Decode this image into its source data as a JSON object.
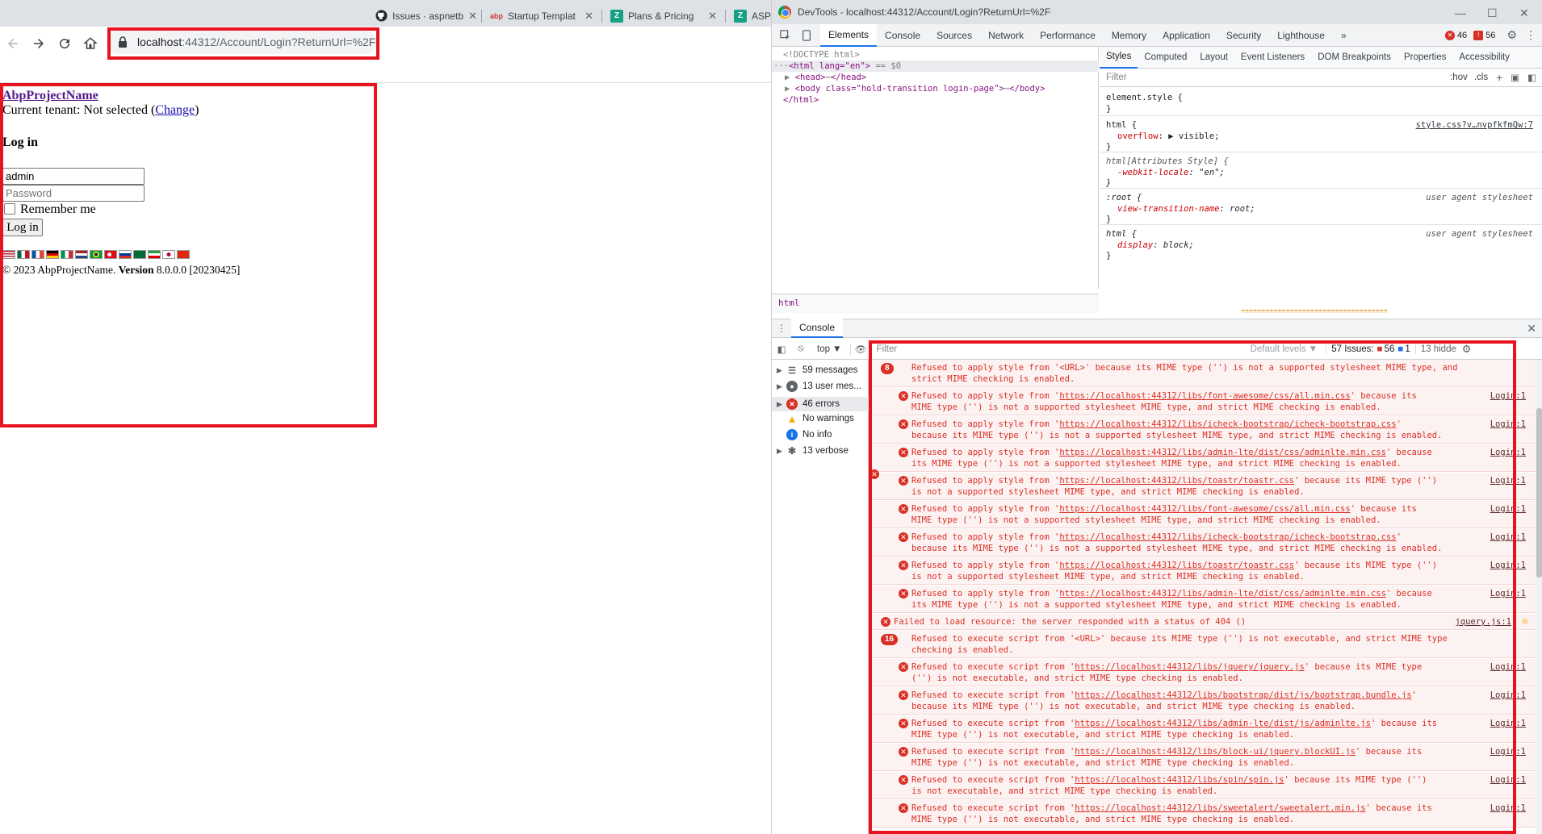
{
  "browser": {
    "tabs": [
      {
        "title": "Issues · aspnetb",
        "icon": "github-icon"
      },
      {
        "title": "Startup Templat",
        "icon": "abp-icon"
      },
      {
        "title": "Plans & Pricing",
        "icon": "zero-icon"
      },
      {
        "title": "ASP",
        "icon": "zero-icon"
      }
    ],
    "url_host": "localhost",
    "url_rest": ":44312/Account/Login?ReturnUrl=%2F"
  },
  "page": {
    "brand": "AbpProjectName",
    "tenant_label": "Current tenant: Not selected (",
    "tenant_change": "Change",
    "tenant_close": ")",
    "login_heading": "Log in",
    "username_value": "admin",
    "password_placeholder": "Password",
    "remember_label": "Remember me",
    "login_button": "Log in",
    "flags": [
      "us",
      "mx",
      "fr",
      "de",
      "it",
      "nl",
      "br",
      "tr",
      "ru",
      "sa",
      "ir",
      "jp",
      "cn"
    ],
    "footer_copy": "© 2023 AbpProjectName.",
    "footer_version_label": "Version",
    "footer_version": "8.0.0.0 [20230425]"
  },
  "devtools": {
    "title": "DevTools - localhost:44312/Account/Login?ReturnUrl=%2F",
    "tabs": [
      "Elements",
      "Console",
      "Sources",
      "Network",
      "Performance",
      "Memory",
      "Application",
      "Security",
      "Lighthouse"
    ],
    "more": "»",
    "error_count": "46",
    "issue_count": "56",
    "elements": {
      "doctype": "<!DOCTYPE html>",
      "html_open": "<html lang=\"en\">",
      "html_eq": "== $0",
      "head": "<head>",
      "head_close": "</head>",
      "body_tag": "<body class=\"hold-transition login-page\">",
      "body_close": "</body>",
      "html_close": "</html>",
      "crumb": "html"
    },
    "styles_tabs": [
      "Styles",
      "Computed",
      "Layout",
      "Event Listeners",
      "DOM Breakpoints",
      "Properties",
      "Accessibility"
    ],
    "styles_filter": "Filter",
    "styles_hov": ":hov",
    "styles_cls": ".cls",
    "rules": [
      {
        "selector": "element.style {",
        "props": [],
        "close": "}",
        "source": ""
      },
      {
        "selector": "html {",
        "props": [
          {
            "name": "overflow",
            "value": "▶ visible;"
          }
        ],
        "close": "}",
        "source": "style.css?v…nvpfkfmQw:7"
      },
      {
        "selector": "html[Attributes Style] {",
        "props": [
          {
            "name": "-webkit-locale",
            "value": "\"en\";"
          }
        ],
        "close": "}",
        "source": ""
      },
      {
        "selector": ":root {",
        "props": [
          {
            "name": "view-transition-name",
            "value": "root;"
          }
        ],
        "close": "}",
        "source": "user agent stylesheet"
      },
      {
        "selector": "html {",
        "props": [
          {
            "name": "display",
            "value": "block;"
          }
        ],
        "close": "}",
        "source": "user agent stylesheet"
      }
    ],
    "console": {
      "title": "Console",
      "context": "top ▼",
      "filter": "Filter",
      "levels": "Default levels ▼",
      "issues_label": "57 Issues:",
      "issues_err": "56",
      "issues_info": "1",
      "hidden": "13 hidde",
      "sidebar": [
        {
          "label": "59 messages",
          "icon": "list-icon"
        },
        {
          "label": "13 user mes...",
          "icon": "user-icon"
        },
        {
          "label": "46 errors",
          "icon": "error-icon"
        },
        {
          "label": "No warnings",
          "icon": "warning-icon"
        },
        {
          "label": "No info",
          "icon": "info-icon"
        },
        {
          "label": "13 verbose",
          "icon": "bug-icon"
        }
      ],
      "messages": [
        {
          "kind": "group",
          "count": "8",
          "l1": "Refused to apply style from '<URL>' because its MIME type ('') is not a supported stylesheet MIME type, and",
          "l2": "strict MIME checking is enabled.",
          "src": ""
        },
        {
          "kind": "item",
          "pre": "Refused to apply style from '",
          "url": "https://localhost:44312/libs/font-awesome/css/all.min.css",
          "post": "' because its",
          "l2": "MIME type ('') is not a supported stylesheet MIME type, and strict MIME checking is enabled.",
          "src": "Login:1"
        },
        {
          "kind": "item",
          "pre": "Refused to apply style from '",
          "url": "https://localhost:44312/libs/icheck-bootstrap/icheck-bootstrap.css",
          "post": "'",
          "l2": "because its MIME type ('') is not a supported stylesheet MIME type, and strict MIME checking is enabled.",
          "src": "Login:1"
        },
        {
          "kind": "item",
          "pre": "Refused to apply style from '",
          "url": "https://localhost:44312/libs/admin-lte/dist/css/adminlte.min.css",
          "post": "' because",
          "l2": "its MIME type ('') is not a supported stylesheet MIME type, and strict MIME checking is enabled.",
          "src": "Login:1"
        },
        {
          "kind": "item",
          "pre": "Refused to apply style from '",
          "url": "https://localhost:44312/libs/toastr/toastr.css",
          "post": "' because its MIME type ('')",
          "l2": "is not a supported stylesheet MIME type, and strict MIME checking is enabled.",
          "src": "Login:1"
        },
        {
          "kind": "item",
          "pre": "Refused to apply style from '",
          "url": "https://localhost:44312/libs/font-awesome/css/all.min.css",
          "post": "' because its",
          "l2": "MIME type ('') is not a supported stylesheet MIME type, and strict MIME checking is enabled.",
          "src": "Login:1"
        },
        {
          "kind": "item",
          "pre": "Refused to apply style from '",
          "url": "https://localhost:44312/libs/icheck-bootstrap/icheck-bootstrap.css",
          "post": "'",
          "l2": "because its MIME type ('') is not a supported stylesheet MIME type, and strict MIME checking is enabled.",
          "src": "Login:1"
        },
        {
          "kind": "item",
          "pre": "Refused to apply style from '",
          "url": "https://localhost:44312/libs/toastr/toastr.css",
          "post": "' because its MIME type ('')",
          "l2": "is not a supported stylesheet MIME type, and strict MIME checking is enabled.",
          "src": "Login:1"
        },
        {
          "kind": "item",
          "pre": "Refused to apply style from '",
          "url": "https://localhost:44312/libs/admin-lte/dist/css/adminlte.min.css",
          "post": "' because",
          "l2": "its MIME type ('') is not a supported stylesheet MIME type, and strict MIME checking is enabled.",
          "src": "Login:1"
        },
        {
          "kind": "single",
          "l1": "Failed to load resource: the server responded with a status of 404 ()",
          "src": "jquery.js:1"
        },
        {
          "kind": "group",
          "count": "16",
          "l1": "Refused to execute script from '<URL>' because its MIME type ('') is not executable, and strict MIME type",
          "l2": "checking is enabled.",
          "src": ""
        },
        {
          "kind": "item",
          "pre": "Refused to execute script from '",
          "url": "https://localhost:44312/libs/jquery/jquery.js",
          "post": "' because its MIME type",
          "l2": "('') is not executable, and strict MIME type checking is enabled.",
          "src": "Login:1"
        },
        {
          "kind": "item",
          "pre": "Refused to execute script from '",
          "url": "https://localhost:44312/libs/bootstrap/dist/js/bootstrap.bundle.js",
          "post": "'",
          "l2": "because its MIME type ('') is not executable, and strict MIME type checking is enabled.",
          "src": "Login:1"
        },
        {
          "kind": "item",
          "pre": "Refused to execute script from '",
          "url": "https://localhost:44312/libs/admin-lte/dist/js/adminlte.js",
          "post": "' because its",
          "l2": "MIME type ('') is not executable, and strict MIME type checking is enabled.",
          "src": "Login:1"
        },
        {
          "kind": "item",
          "pre": "Refused to execute script from '",
          "url": "https://localhost:44312/libs/block-ui/jquery.blockUI.js",
          "post": "' because its",
          "l2": "MIME type ('') is not executable, and strict MIME type checking is enabled.",
          "src": "Login:1"
        },
        {
          "kind": "item",
          "pre": "Refused to execute script from '",
          "url": "https://localhost:44312/libs/spin/spin.js",
          "post": "' because its MIME type ('')",
          "l2": "is not executable, and strict MIME type checking is enabled.",
          "src": "Login:1"
        },
        {
          "kind": "item",
          "pre": "Refused to execute script from '",
          "url": "https://localhost:44312/libs/sweetalert/sweetalert.min.js",
          "post": "' because its",
          "l2": "MIME type ('') is not executable, and strict MIME type checking is enabled.",
          "src": "Login:1"
        }
      ]
    }
  }
}
